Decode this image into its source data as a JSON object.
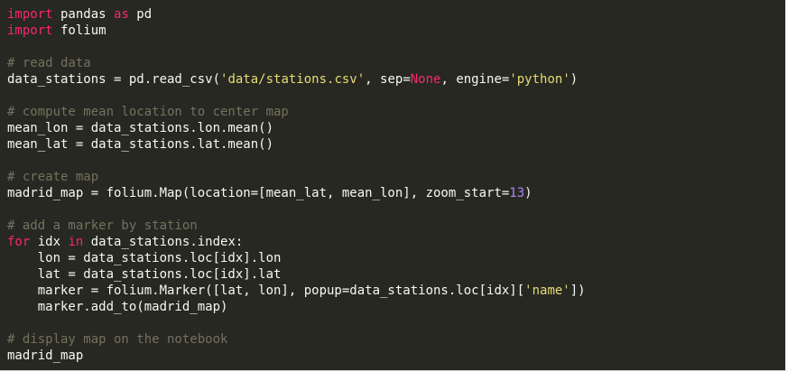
{
  "colors": {
    "background": "#272822",
    "text": "#f8f8f2",
    "keyword": "#f92672",
    "comment": "#75715e",
    "string": "#e6db74",
    "number": "#ae81ff"
  },
  "code": {
    "lines": [
      [
        {
          "t": "kw",
          "v": "import"
        },
        {
          "t": "tx",
          "v": " pandas "
        },
        {
          "t": "kw",
          "v": "as"
        },
        {
          "t": "tx",
          "v": " pd"
        }
      ],
      [
        {
          "t": "kw",
          "v": "import"
        },
        {
          "t": "tx",
          "v": " folium"
        }
      ],
      [],
      [
        {
          "t": "cm",
          "v": "# read data"
        }
      ],
      [
        {
          "t": "tx",
          "v": "data_stations = pd.read_csv("
        },
        {
          "t": "str",
          "v": "'data/stations.csv'"
        },
        {
          "t": "tx",
          "v": ", sep="
        },
        {
          "t": "const",
          "v": "None"
        },
        {
          "t": "tx",
          "v": ", engine="
        },
        {
          "t": "str",
          "v": "'python'"
        },
        {
          "t": "tx",
          "v": ")"
        }
      ],
      [],
      [
        {
          "t": "cm",
          "v": "# compute mean location to center map"
        }
      ],
      [
        {
          "t": "tx",
          "v": "mean_lon = data_stations.lon.mean()"
        }
      ],
      [
        {
          "t": "tx",
          "v": "mean_lat = data_stations.lat.mean()"
        }
      ],
      [],
      [
        {
          "t": "cm",
          "v": "# create map"
        }
      ],
      [
        {
          "t": "tx",
          "v": "madrid_map = folium.Map(location=[mean_lat, mean_lon], zoom_start="
        },
        {
          "t": "num",
          "v": "13"
        },
        {
          "t": "tx",
          "v": ")"
        }
      ],
      [],
      [
        {
          "t": "cm",
          "v": "# add a marker by station"
        }
      ],
      [
        {
          "t": "kw",
          "v": "for"
        },
        {
          "t": "tx",
          "v": " idx "
        },
        {
          "t": "kw",
          "v": "in"
        },
        {
          "t": "tx",
          "v": " data_stations.index:"
        }
      ],
      [
        {
          "t": "tx",
          "v": "    lon = data_stations.loc[idx].lon"
        }
      ],
      [
        {
          "t": "tx",
          "v": "    lat = data_stations.loc[idx].lat"
        }
      ],
      [
        {
          "t": "tx",
          "v": "    marker = folium.Marker([lat, lon], popup=data_stations.loc[idx]["
        },
        {
          "t": "str",
          "v": "'name'"
        },
        {
          "t": "tx",
          "v": "])"
        }
      ],
      [
        {
          "t": "tx",
          "v": "    marker.add_to(madrid_map)"
        }
      ],
      [],
      [
        {
          "t": "cm",
          "v": "# display map on the notebook"
        }
      ],
      [
        {
          "t": "tx",
          "v": "madrid_map"
        }
      ]
    ]
  }
}
